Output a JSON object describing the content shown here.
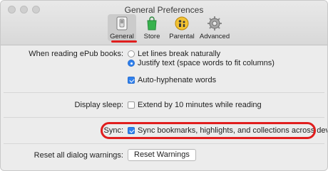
{
  "window": {
    "title": "General Preferences"
  },
  "toolbar": {
    "tabs": [
      {
        "label": "General",
        "icon": "general-switch-icon"
      },
      {
        "label": "Store",
        "icon": "store-bag-icon"
      },
      {
        "label": "Parental",
        "icon": "parental-controls-icon"
      },
      {
        "label": "Advanced",
        "icon": "advanced-gear-icon"
      }
    ],
    "active": "General"
  },
  "epub": {
    "label": "When reading ePub books:",
    "opt_let_lines": "Let lines break naturally",
    "opt_justify": "Justify text (space words to fit columns)",
    "auto_hyphenate": "Auto-hyphenate words"
  },
  "display_sleep": {
    "label": "Display sleep:",
    "option": "Extend by 10 minutes while reading"
  },
  "sync": {
    "label": "Sync:",
    "option": "Sync bookmarks, highlights, and collections across devices"
  },
  "reset": {
    "label": "Reset all dialog warnings:",
    "button": "Reset Warnings"
  },
  "colors": {
    "accent": "#2f80ed",
    "annotation": "#e01e1e"
  }
}
